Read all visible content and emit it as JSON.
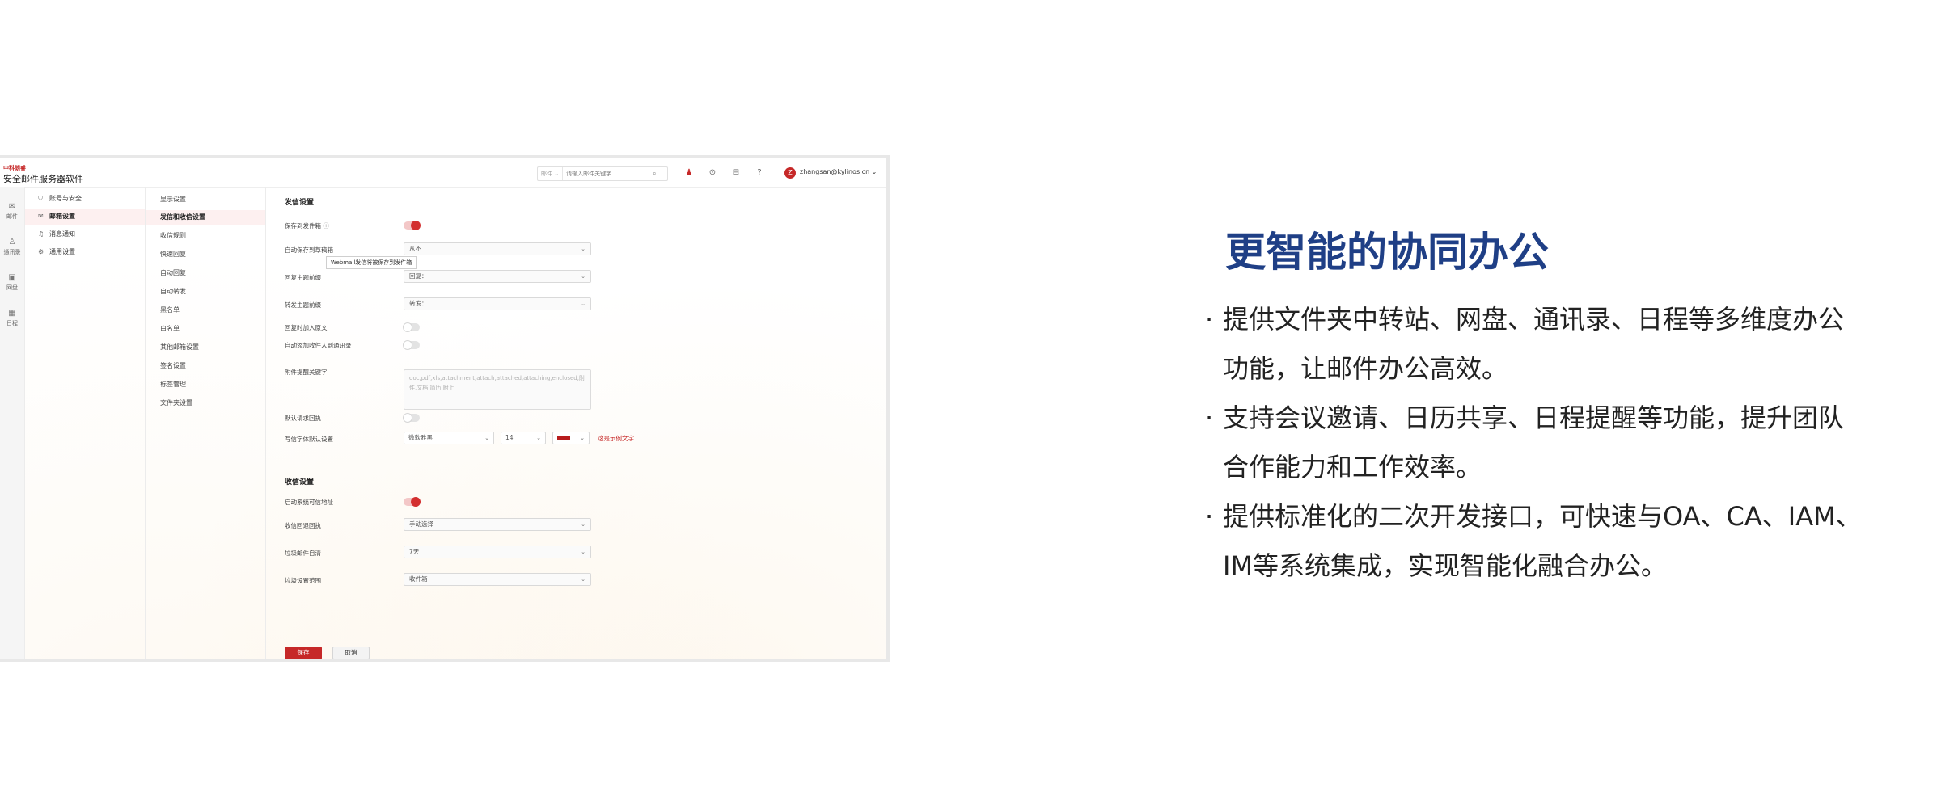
{
  "app": {
    "logo_text": "中科朗睿",
    "title": "安全邮件服务器软件",
    "search": {
      "scope": "邮件 ⌄",
      "placeholder": "请输入邮件关键字"
    },
    "user": {
      "avatar_letter": "Z",
      "email": "zhangsan@kylinos.cn ⌄"
    }
  },
  "icon_nav": [
    {
      "label": "邮件",
      "icon": "mail-icon"
    },
    {
      "label": "通讯录",
      "icon": "contacts-icon"
    },
    {
      "label": "网盘",
      "icon": "drive-icon"
    },
    {
      "label": "日程",
      "icon": "calendar-icon"
    }
  ],
  "categories": [
    {
      "label": "账号与安全",
      "icon": "shield-icon"
    },
    {
      "label": "邮箱设置",
      "icon": "mail-icon",
      "active": true
    },
    {
      "label": "消息通知",
      "icon": "bell-icon"
    },
    {
      "label": "通用设置",
      "icon": "gear-icon"
    }
  ],
  "sub_menu": [
    "显示设置",
    "发信和收信设置",
    "收信规则",
    "快速回复",
    "自动回复",
    "自动转发",
    "黑名单",
    "白名单",
    "其他邮箱设置",
    "签名设置",
    "标签管理",
    "文件夹设置"
  ],
  "form": {
    "send_section": "发信设置",
    "save_sent_label": "保存到发件箱",
    "tooltip": "Webmail发信将被保存到发件箱",
    "auto_save_draft_label": "自动保存到草稿箱",
    "auto_save_draft_value": "从不",
    "reply_prefix_label": "回复主题前缀",
    "reply_prefix_value": "回复：",
    "forward_prefix_label": "转发主题前缀",
    "forward_prefix_value": "转发：",
    "reply_include_label": "回复时加入原文",
    "auto_add_contact_label": "自动添加收件人到通讯录",
    "attachment_keywords_label": "附件提醒关键字",
    "attachment_keywords_value": "doc,pdf,xls,attachment,attach,attached,attaching,enclosed,附件,文档,简历,附上",
    "read_receipt_label": "默认请求回执",
    "font_default_label": "写信字体默认设置",
    "font_family_value": "微软雅黑",
    "font_size_value": "14",
    "font_preview": "这是示例文字",
    "receive_section": "收信设置",
    "trust_label": "启动系统可信地址",
    "receive_receipt_label": "收信回退回执",
    "receive_receipt_value": "手动选择",
    "spam_days_label": "垃圾邮件自清",
    "spam_days_value": "7天",
    "spam_scope_label": "垃圾设置范围",
    "spam_scope_value": "收件箱",
    "save_label": "保存",
    "cancel_label": "取消"
  },
  "marketing": {
    "headline": "更智能的协同办公",
    "bullets": [
      {
        "dot": "·",
        "line1": "提供文件夹中转站、网盘、通讯录、日程等多维度办公",
        "line2": "功能，让邮件办公高效。"
      },
      {
        "dot": "·",
        "line1": "支持会议邀请、日历共享、日程提醒等功能，提升团队",
        "line2": "合作能力和工作效率。"
      },
      {
        "dot": "·",
        "line1": "提供标准化的二次开发接口，可快速与OA、CA、IAM、",
        "line2": "IM等系统集成，实现智能化融合办公。"
      }
    ]
  },
  "colors": {
    "accent": "#c62828",
    "headline": "#1f3f86"
  }
}
